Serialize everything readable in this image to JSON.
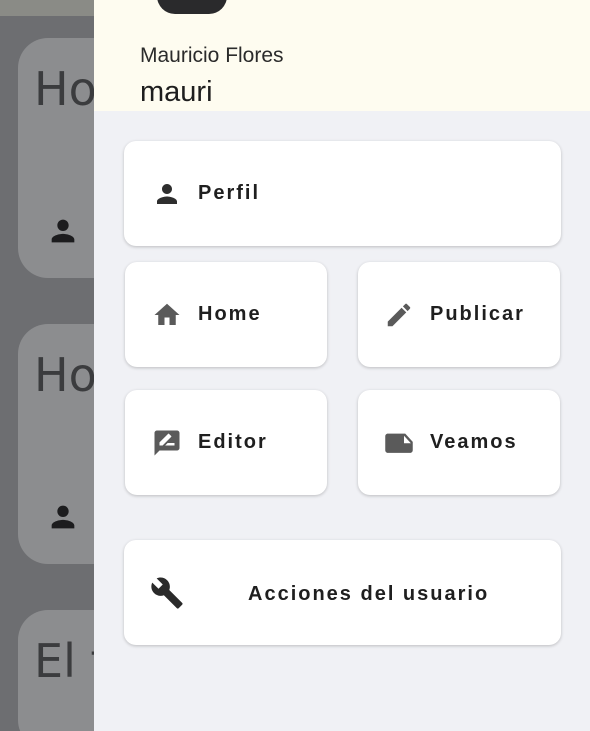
{
  "background": {
    "cards": [
      {
        "title_fragment": "Ho"
      },
      {
        "title_fragment": "Ho"
      },
      {
        "title_fragment": "El t"
      }
    ]
  },
  "drawer": {
    "user": {
      "name": "Mauricio Flores",
      "handle": "mauri"
    },
    "items": [
      {
        "label": "Perfil",
        "icon": "person-icon"
      },
      {
        "label": "Home",
        "icon": "home-icon"
      },
      {
        "label": "Publicar",
        "icon": "pencil-icon"
      },
      {
        "label": "Editor",
        "icon": "rate-review-icon"
      },
      {
        "label": "Veamos",
        "icon": "sticky-note-icon"
      },
      {
        "label": "Acciones del usuario",
        "icon": "wrench-icon"
      }
    ]
  },
  "colors": {
    "drawer_bg": "#f0f1f5",
    "header_bg": "#fefcf0",
    "icon_color": "#3a3a3a",
    "scrim": "#6d6e71"
  }
}
